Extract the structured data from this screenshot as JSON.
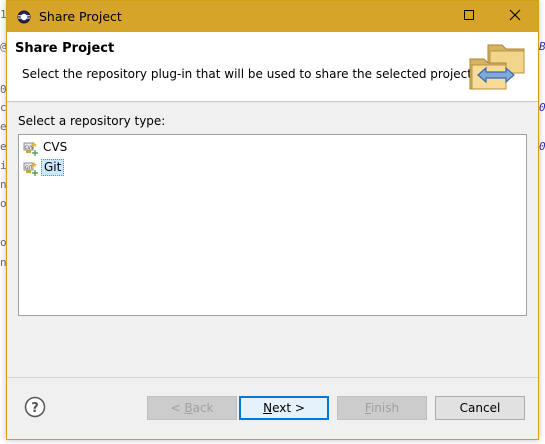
{
  "window": {
    "title": "Share Project"
  },
  "header": {
    "title": "Share Project",
    "description": "Select the repository plug-in that will be used to share the selected project."
  },
  "repository": {
    "label": "Select a repository type:",
    "items": [
      {
        "label": "CVS",
        "icon": "cvs-repository-icon",
        "selected": false
      },
      {
        "label": "Git",
        "icon": "git-repository-icon",
        "selected": true
      }
    ]
  },
  "buttons": {
    "back_prefix": "< ",
    "back_mnemonic": "B",
    "back_rest": "ack",
    "next_mnemonic": "N",
    "next_rest": "ext >",
    "finish_mnemonic": "F",
    "finish_rest": "inish",
    "cancel": "Cancel"
  },
  "background_glyphs": [
    "1",
    "@",
    "0",
    "cr",
    "ea",
    "et",
    "i",
    "ne",
    "oc",
    "oc",
    "nt",
    "B",
    "0",
    "0"
  ],
  "colors": {
    "titlebar": "#d6a428",
    "selection": "#cce8ff",
    "default_button_border": "#0078d7"
  }
}
